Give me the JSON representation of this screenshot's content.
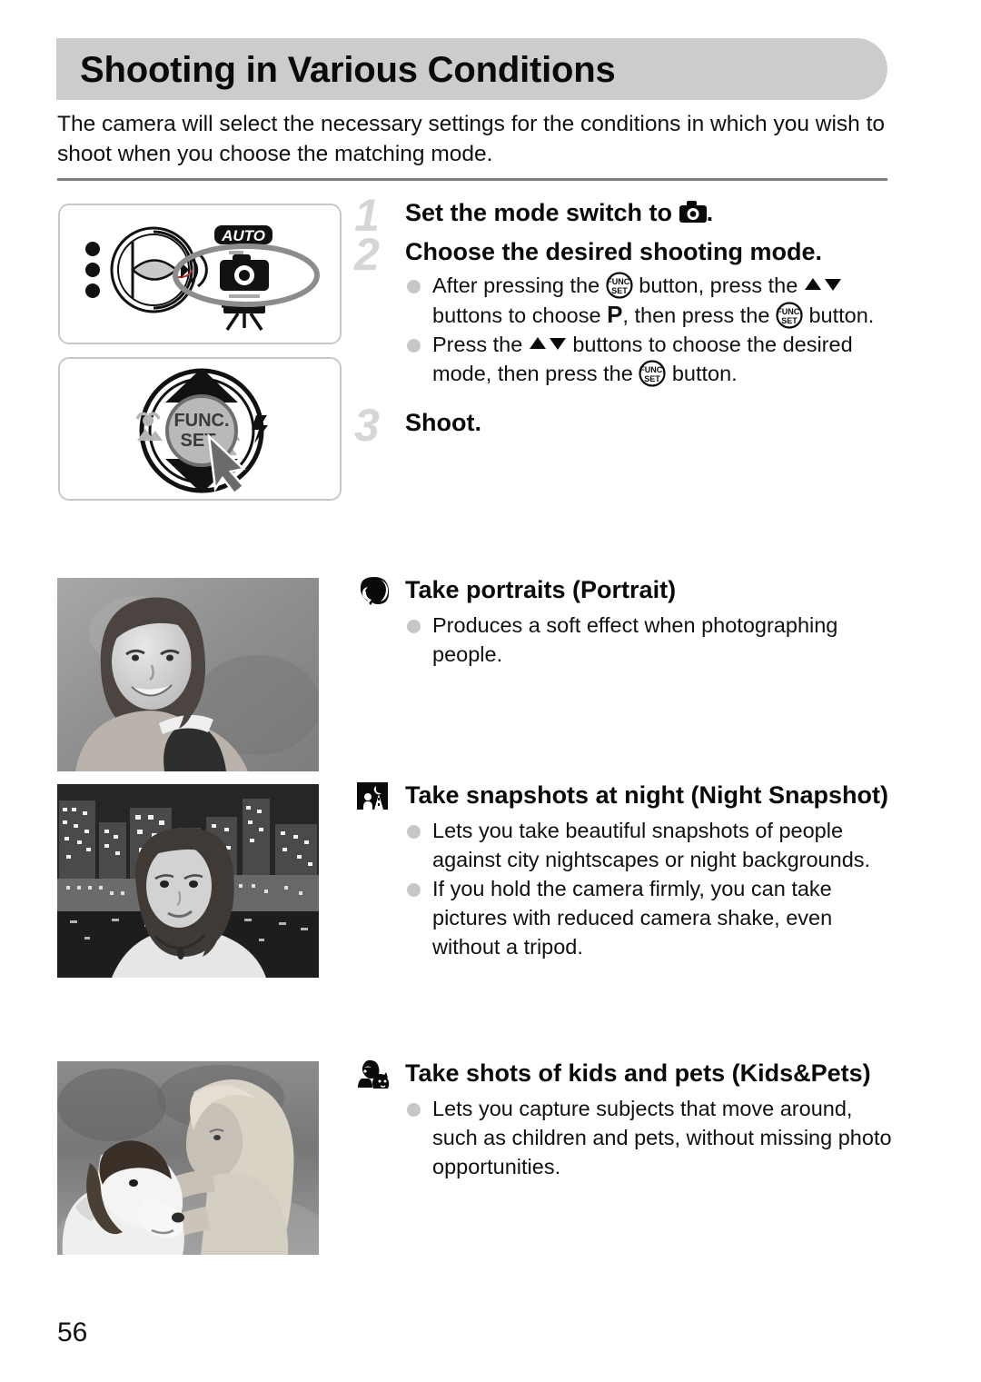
{
  "page": {
    "title": "Shooting in Various Conditions",
    "intro": "The camera will select the necessary settings for the conditions in which you wish to shoot when you choose the matching mode.",
    "page_number": "56"
  },
  "colors": {
    "header_band": "#cccccc",
    "rule": "#808080",
    "step_number": "#d6d6d6",
    "bullet": "#c7c7c7",
    "box_border": "#c9c9c9",
    "text": "#111111"
  },
  "steps": [
    {
      "number": "1",
      "title_before": "Set the mode switch to",
      "title_icon": "still-camera-icon",
      "title_after": ".",
      "bullets": []
    },
    {
      "number": "2",
      "title_before": "Choose the desired shooting mode.",
      "title_icon": "",
      "title_after": "",
      "bullets": [
        {
          "parts": [
            {
              "t": "text",
              "v": "After pressing the "
            },
            {
              "t": "icon",
              "v": "func-set-button-icon"
            },
            {
              "t": "text",
              "v": " button, press the "
            },
            {
              "t": "icon",
              "v": "up-down-buttons-icon"
            },
            {
              "t": "text",
              "v": " buttons to choose "
            },
            {
              "t": "icon",
              "v": "program-mode-p-icon"
            },
            {
              "t": "text",
              "v": ", then press the "
            },
            {
              "t": "icon",
              "v": "func-set-button-icon"
            },
            {
              "t": "text",
              "v": " button."
            }
          ]
        },
        {
          "parts": [
            {
              "t": "text",
              "v": "Press the "
            },
            {
              "t": "icon",
              "v": "up-down-buttons-icon"
            },
            {
              "t": "text",
              "v": " buttons to choose the desired mode, then press the "
            },
            {
              "t": "icon",
              "v": "func-set-button-icon"
            },
            {
              "t": "text",
              "v": " button."
            }
          ]
        }
      ]
    },
    {
      "number": "3",
      "title_before": "Shoot.",
      "title_icon": "",
      "title_after": "",
      "bullets": []
    }
  ],
  "modes": [
    {
      "icon": "portrait-mode-icon",
      "heading": "Take portraits (Portrait)",
      "bullets": [
        "Produces a soft effect when photographing people."
      ],
      "photo_alt": "smiling-woman-portrait-photo"
    },
    {
      "icon": "night-snapshot-mode-icon",
      "heading": "Take snapshots at night (Night Snapshot)",
      "bullets": [
        "Lets you take beautiful snapshots of people against city nightscapes or night backgrounds.",
        "If you hold the camera firmly, you can take pictures with reduced camera shake, even without a tripod."
      ],
      "photo_alt": "woman-against-city-nightscape-photo"
    },
    {
      "icon": "kids-and-pets-mode-icon",
      "heading": "Take shots of kids and pets (Kids&Pets)",
      "bullets": [
        "Lets you capture subjects that move around, such as children and pets, without missing photo opportunities."
      ],
      "photo_alt": "girl-hugging-dog-photo"
    }
  ],
  "illustrations": {
    "mode_switch": {
      "name": "mode-switch-illustration",
      "labels": [
        "AUTO"
      ],
      "highlighted_position": "still-camera-icon"
    },
    "controller": {
      "name": "four-way-controller-illustration",
      "center_label_line1": "FUNC.",
      "center_label_line2": "SET"
    }
  }
}
